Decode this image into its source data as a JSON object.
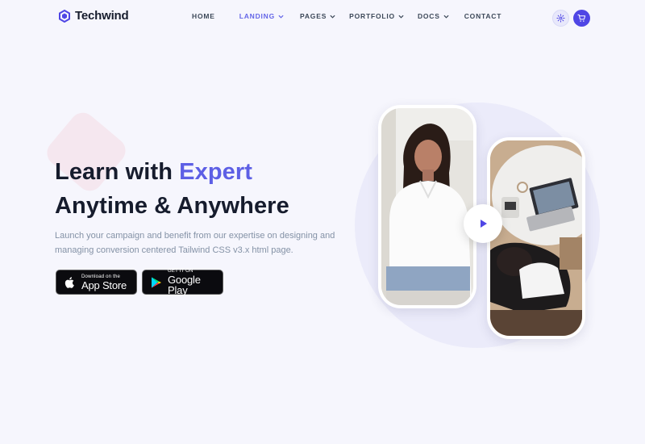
{
  "brand": {
    "name": "Techwind",
    "color": "#4f46e5"
  },
  "nav": {
    "items": [
      {
        "label": "HOME",
        "dropdown": false,
        "active": false
      },
      {
        "label": "LANDING",
        "dropdown": true,
        "active": true
      },
      {
        "label": "PAGES",
        "dropdown": true,
        "active": false
      },
      {
        "label": "PORTFOLIO",
        "dropdown": true,
        "active": false
      },
      {
        "label": "DOCS",
        "dropdown": true,
        "active": false
      },
      {
        "label": "CONTACT",
        "dropdown": false,
        "active": false
      }
    ],
    "icons": [
      "settings-icon",
      "cart-icon"
    ]
  },
  "hero": {
    "title_prefix": "Learn with ",
    "title_accent": "Expert",
    "title_line2": "Anytime & Anywhere",
    "description": "Launch your campaign and benefit from our expertise on designing and managing conversion centered Tailwind CSS v3.x html page.",
    "accent_color": "#5d5fe5",
    "app_store": {
      "small": "Download on the",
      "big": "App Store"
    },
    "google_play": {
      "small": "GET IT ON",
      "big": "Google Play"
    },
    "play_icon": "play-icon"
  }
}
